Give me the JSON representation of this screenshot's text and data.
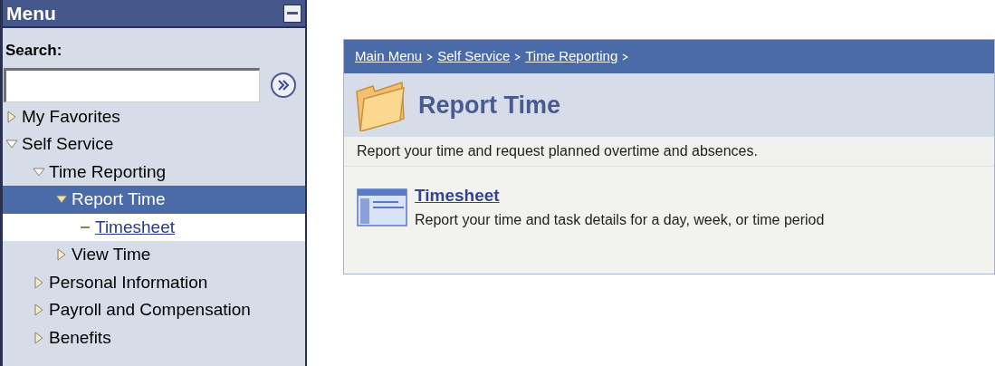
{
  "menu": {
    "title": "Menu",
    "search": {
      "label": "Search:"
    },
    "items": [
      {
        "label": "My Favorites",
        "kind": "folder",
        "expanded": false,
        "selected": false
      },
      {
        "label": "Self Service",
        "kind": "folder",
        "expanded": true,
        "selected": false,
        "children": [
          {
            "label": "Time Reporting",
            "kind": "folder",
            "expanded": true,
            "selected": false,
            "children": [
              {
                "label": "Report Time",
                "kind": "folder",
                "expanded": true,
                "selected": true,
                "children": [
                  {
                    "label": "Timesheet",
                    "kind": "link",
                    "selected": false
                  }
                ]
              },
              {
                "label": "View Time",
                "kind": "folder",
                "expanded": false,
                "selected": false
              }
            ]
          },
          {
            "label": "Personal Information",
            "kind": "folder",
            "expanded": false,
            "selected": false
          },
          {
            "label": "Payroll and Compensation",
            "kind": "folder",
            "expanded": false,
            "selected": false
          },
          {
            "label": "Benefits",
            "kind": "folder",
            "expanded": false,
            "selected": false
          }
        ]
      }
    ]
  },
  "breadcrumb": [
    "Main Menu",
    "Self Service",
    "Time Reporting"
  ],
  "page": {
    "title": "Report Time",
    "description": "Report your time and request planned overtime and absences.",
    "links": [
      {
        "label": "Timesheet",
        "description": "Report your time and task details for a day, week, or time period"
      }
    ]
  }
}
